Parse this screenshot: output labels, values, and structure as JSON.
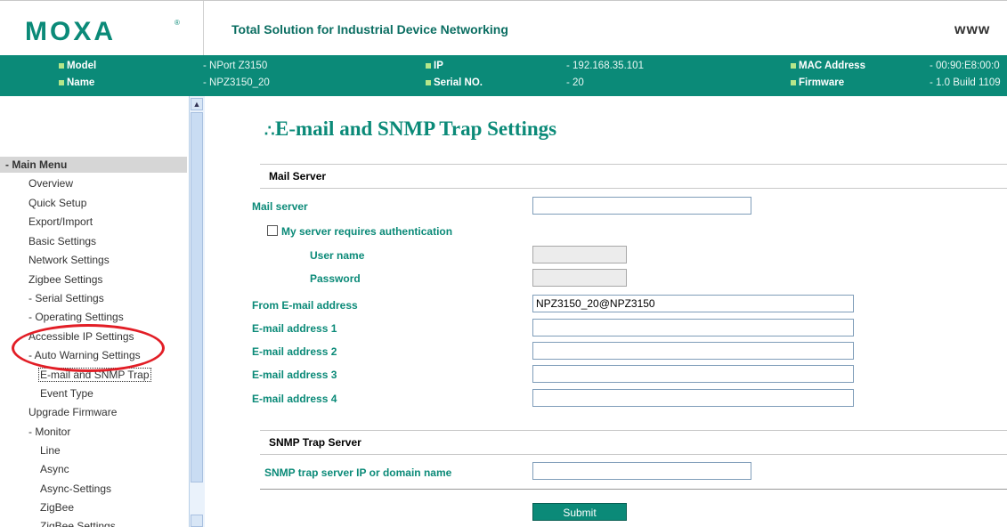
{
  "header": {
    "logo": "MOXA",
    "logo_mark": "®",
    "tagline": "Total Solution for Industrial Device Networking",
    "site": "www"
  },
  "device_info": {
    "model_label": "Model",
    "model_value": "- NPort Z3150",
    "name_label": "Name",
    "name_value": "- NPZ3150_20",
    "ip_label": "IP",
    "ip_value": "- 192.168.35.101",
    "serial_label": "Serial NO.",
    "serial_value": "- 20",
    "mac_label": "MAC Address",
    "mac_value": "- 00:90:E8:00:0",
    "fw_label": "Firmware",
    "fw_value": "- 1.0 Build 1109"
  },
  "nav": {
    "main_menu": "- Main Menu",
    "items": [
      "Overview",
      "Quick Setup",
      "Export/Import",
      "Basic Settings",
      "Network Settings",
      "Zigbee Settings",
      "- Serial Settings",
      "- Operating Settings",
      "Accessible IP Settings",
      "- Auto Warning Settings",
      "E-mail and SNMP Trap",
      "Event Type",
      "Upgrade Firmware",
      "- Monitor",
      "Line",
      "Async",
      "Async-Settings",
      "ZigBee",
      "ZigBee Settings"
    ]
  },
  "page": {
    "title": "E-mail and SNMP Trap Settings",
    "mail_section": "Mail Server",
    "mail_server_label": "Mail server",
    "mail_server_value": "",
    "auth_label": "My server requires authentication",
    "auth_checked": false,
    "username_label": "User name",
    "password_label": "Password",
    "from_label": "From E-mail address",
    "from_value": "NPZ3150_20@NPZ3150",
    "email1_label": "E-mail address 1",
    "email2_label": "E-mail address 2",
    "email3_label": "E-mail address 3",
    "email4_label": "E-mail address 4",
    "snmp_section": "SNMP Trap Server",
    "snmp_label": "SNMP trap server IP or domain name",
    "snmp_value": "",
    "submit_label": "Submit"
  },
  "colors": {
    "brand": "#0b8a78",
    "highlight_circle": "#e21e26"
  }
}
